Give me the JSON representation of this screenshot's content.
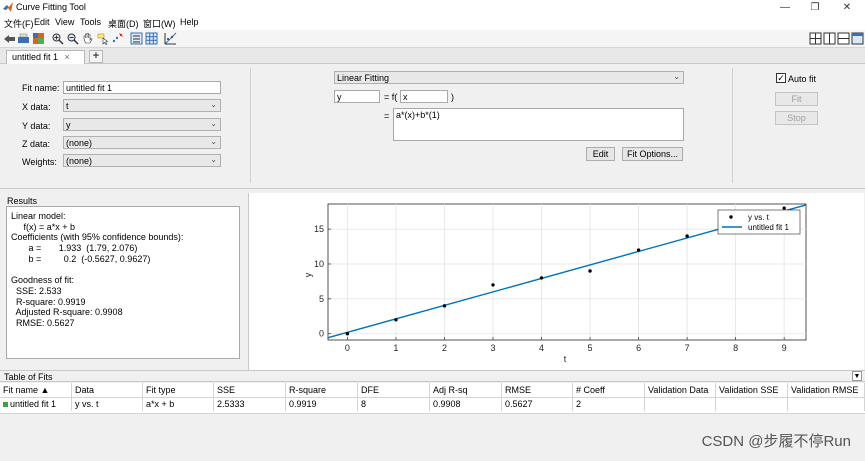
{
  "window": {
    "title": "Curve Fitting Tool",
    "controls": [
      "—",
      "❐",
      "✕"
    ]
  },
  "menu": [
    "文件(F)",
    "Edit",
    "View",
    "Tools",
    "桌面(D)",
    "窗口(W)",
    "Help"
  ],
  "toolbar": {
    "icons": [
      "open-session-icon",
      "data-icon",
      "color-icon",
      "zoom-in-icon",
      "zoom-out-icon",
      "pan-icon",
      "data-cursor-icon",
      "exclude-outliers-icon",
      "legend-icon",
      "grid-icon",
      "residuals-icon"
    ],
    "layout_icons": [
      "tile-layout-icon",
      "column-layout-icon",
      "row-layout-icon",
      "single-layout-icon"
    ]
  },
  "tabs": [
    {
      "label": "untitled fit 1",
      "close": "×"
    }
  ],
  "tab_add": "+",
  "fit": {
    "fit_name_label": "Fit name:",
    "fit_name_value": "untitled fit 1",
    "x_label": "X data:",
    "x_value": "t",
    "y_label": "Y data:",
    "y_value": "y",
    "z_label": "Z data:",
    "z_value": "(none)",
    "w_label": "Weights:",
    "w_value": "(none)",
    "type_value": "Linear Fitting",
    "response": "y",
    "eq_prefix": "= f(",
    "predictor": "x",
    "eq_suffix": ")",
    "eq_equals": "=",
    "equation": "a*(x)+b*(1)",
    "edit_label": "Edit",
    "options_label": "Fit Options...",
    "autofit_label": "Auto fit",
    "autofit_check": "✓",
    "fit_button": "Fit",
    "stop_button": "Stop"
  },
  "results": {
    "title": "Results",
    "lines": [
      "Linear model:",
      "     f(x) = a*x + b",
      "Coefficients (with 95% confidence bounds):",
      "       a =       1.933  (1.79, 2.076)",
      "       b =         0.2  (-0.5627, 0.9627)",
      "",
      "Goodness of fit:",
      "  SSE: 2.533",
      "  R-square: 0.9919",
      "  Adjusted R-square: 0.9908",
      "  RMSE: 0.5627"
    ]
  },
  "chart_data": {
    "type": "scatter",
    "title": "",
    "xlabel": "t",
    "ylabel": "y",
    "xlim": [
      -0.4,
      9.45
    ],
    "ylim": [
      -0.9,
      18.6
    ],
    "xticks": [
      0,
      1,
      2,
      3,
      4,
      5,
      6,
      7,
      8,
      9
    ],
    "yticks": [
      0,
      5,
      10,
      15
    ],
    "grid": true,
    "legend_position": "top-right",
    "legend": [
      "y vs. t",
      "untitled fit 1"
    ],
    "points": {
      "name": "y vs. t",
      "x": [
        0,
        1,
        2,
        3,
        4,
        5,
        6,
        7,
        9
      ],
      "y": [
        0,
        2,
        4,
        7,
        8,
        9,
        12,
        14,
        18
      ]
    },
    "fit_line": {
      "name": "untitled fit 1",
      "slope": 1.933,
      "intercept": 0.2,
      "color": "#0072bd"
    }
  },
  "table_of_fits": {
    "title": "Table of Fits",
    "collapse": "▼",
    "columns": [
      "Fit name ▲",
      "Data",
      "Fit type",
      "SSE",
      "R-square",
      "DFE",
      "Adj R-sq",
      "RMSE",
      "# Coeff",
      "Validation Data",
      "Validation SSE",
      "Validation RMSE"
    ],
    "rows": [
      [
        "untitled fit 1",
        "y vs. t",
        "a*x + b",
        "2.5333",
        "0.9919",
        "8",
        "0.9908",
        "0.5627",
        "2",
        "",
        "",
        ""
      ]
    ]
  },
  "watermark": "CSDN @步履不停Run"
}
